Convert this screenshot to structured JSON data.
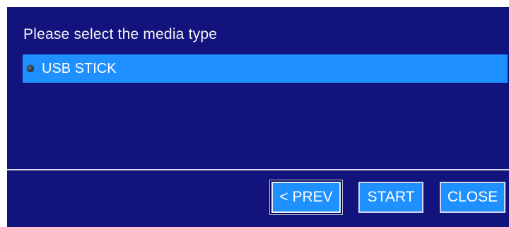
{
  "dialog": {
    "prompt": "Please select the media type",
    "options": [
      {
        "label": "USB STICK",
        "selected": true
      }
    ]
  },
  "buttons": {
    "prev_label": "< PREV",
    "start_label": "START",
    "close_label": "CLOSE"
  },
  "colors": {
    "background": "#13137e",
    "highlight": "#1e90ff",
    "text": "#ffffff"
  }
}
